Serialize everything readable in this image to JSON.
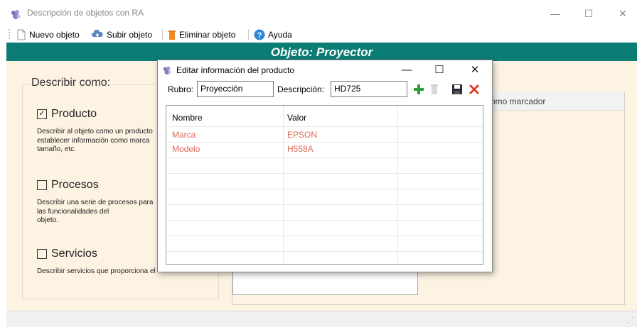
{
  "window": {
    "title": "Descripción de objetos con RA",
    "min": "—",
    "max": "☐",
    "close": "✕"
  },
  "toolbar": {
    "new_label": "Nuevo objeto",
    "upload_label": "Subir objeto",
    "delete_label": "Eliminar objeto",
    "help_label": "Ayuda"
  },
  "banner": {
    "title": "Objeto: Proyector"
  },
  "left_panel": {
    "heading": "Describir como:",
    "options": [
      {
        "label": "Producto",
        "checked": true,
        "mark": "✓",
        "desc": [
          "Describir al objeto como un producto",
          "establecer información como marca",
          "tamaño, etc."
        ]
      },
      {
        "label": "Procesos",
        "checked": false,
        "mark": "",
        "desc": [
          "Describir una serie de procesos para",
          "las funcionalidades del",
          "objeto."
        ]
      },
      {
        "label": "Servicios",
        "checked": false,
        "mark": "",
        "desc": [
          "Describir servicios que proporciona el"
        ]
      }
    ]
  },
  "right_panel": {
    "marker_tab": "omo marcador"
  },
  "dialog": {
    "title": "Editar información del producto",
    "min": "—",
    "max": "☐",
    "close": "✕",
    "rubro_label": "Rubro:",
    "rubro_value": "Proyección",
    "descripcion_label": "Descripción:",
    "descripcion_value": "HD725",
    "columns": [
      "Nombre",
      "Valor"
    ],
    "rows": [
      {
        "nombre": "Marca",
        "valor": "EPSON"
      },
      {
        "nombre": "Modelo",
        "valor": "H558A"
      }
    ]
  },
  "colors": {
    "banner": "#0b7d75",
    "background": "#fdf3e3",
    "row_text": "#e06a5a",
    "add_icon": "#2e9e3e",
    "cancel_icon": "#e03a2a"
  },
  "icons": [
    "app-icon",
    "new-object-icon",
    "cloud-upload-icon",
    "trash-icon",
    "help-icon",
    "add-icon",
    "delete-icon",
    "save-icon",
    "cancel-icon"
  ]
}
